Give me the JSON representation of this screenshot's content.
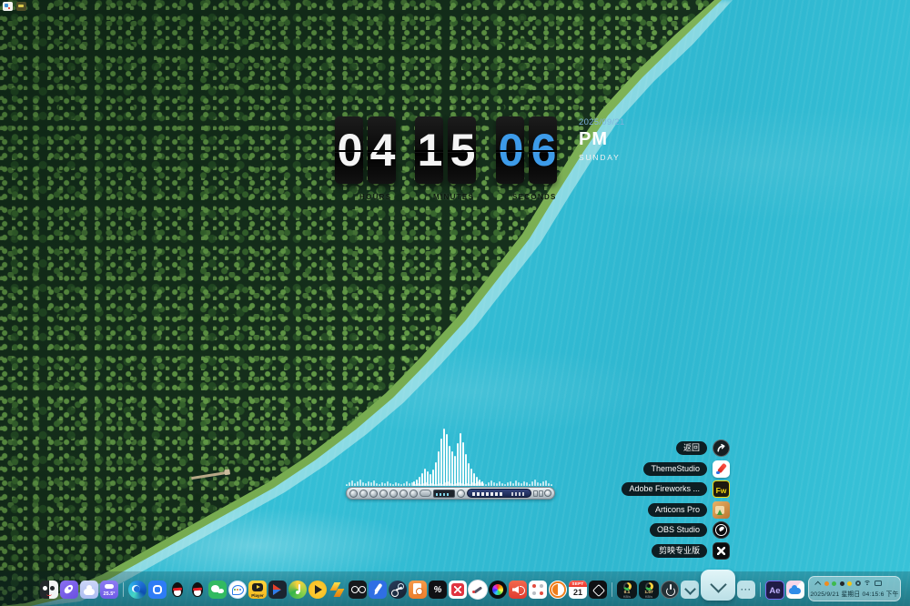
{
  "clock": {
    "digits": [
      "0",
      "4",
      "1",
      "5",
      "0",
      "6"
    ],
    "hours": "04",
    "minutes": "15",
    "seconds": "06",
    "hours_label": "HOURS",
    "minutes_label": "MINUTES",
    "seconds_label": "SECONDS",
    "date": "2025/09/21",
    "meridiem": "PM",
    "weekday": "SUNDAY",
    "seconds_color": "#3d9be9"
  },
  "shortcuts": {
    "items": [
      {
        "label": "返回",
        "icon": "back-icon"
      },
      {
        "label": "ThemeStudio",
        "icon": "theme-studio-icon"
      },
      {
        "label": "Adobe Fireworks ...",
        "icon": "fireworks-icon"
      },
      {
        "label": "Articons Pro",
        "icon": "articons-icon"
      },
      {
        "label": "OBS Studio",
        "icon": "obs-icon"
      },
      {
        "label": "剪映专业版",
        "icon": "capcut-icon"
      }
    ],
    "fireworks_text": "Fw"
  },
  "player": {
    "spectrum_main": [
      5,
      7,
      10,
      14,
      19,
      16,
      13,
      18,
      26,
      38,
      52,
      63,
      57,
      44,
      38,
      33,
      47,
      58,
      48,
      35,
      25,
      19,
      14,
      10,
      7,
      5
    ],
    "spectrum_base": [
      2,
      4,
      6,
      3,
      5,
      7,
      4,
      3,
      5,
      4,
      6,
      3,
      2,
      4,
      3,
      5,
      3,
      2,
      4,
      3,
      2,
      3,
      5,
      3,
      4,
      2,
      3,
      2,
      3,
      4,
      2,
      3,
      2,
      2,
      3,
      2,
      4,
      5,
      3,
      2,
      3,
      4,
      3,
      2,
      3,
      2,
      4,
      3,
      5,
      4,
      3,
      2,
      4,
      6,
      4,
      3,
      5,
      3,
      2,
      4,
      5,
      3,
      6,
      4,
      3,
      5,
      4,
      2,
      5,
      7,
      4,
      3,
      5,
      6,
      3,
      2
    ]
  },
  "dock": {
    "weather_temp": "25.5°",
    "player_label": "Player",
    "percent_glyph": "%",
    "calendar_month": "SEPT",
    "calendar_day": "21",
    "net_up": {
      "value": "0.1",
      "unit": "KB/s"
    },
    "net_down": {
      "value": "1.07",
      "unit": "KB/s"
    },
    "more_label": "···",
    "ae_label": "Ae"
  },
  "tray": {
    "datetime": "2025/9/21 星期日 04:15:6 下午"
  },
  "colors": {
    "water": "#31bcd2",
    "seconds_blue": "#3d9be9"
  }
}
